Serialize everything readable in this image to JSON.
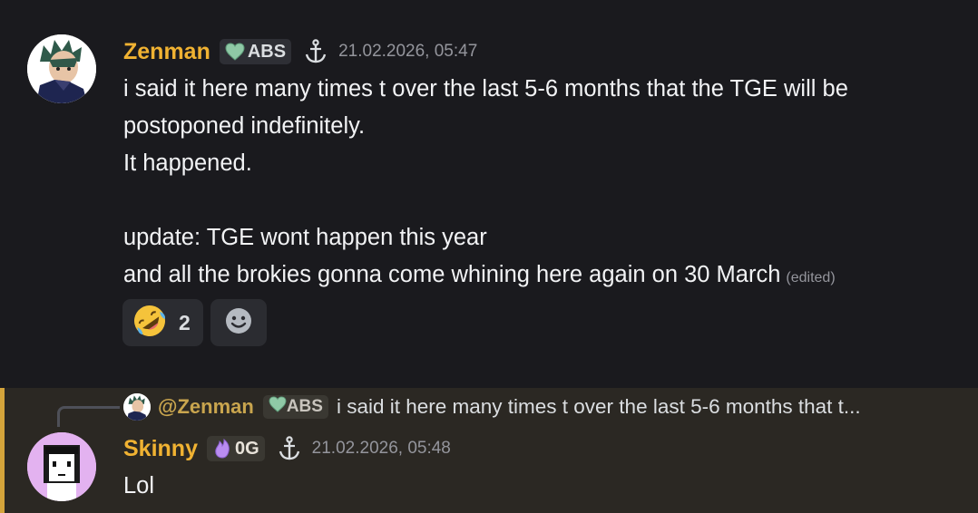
{
  "message1": {
    "username": "Zenman",
    "username_color": "#f0b232",
    "tag": {
      "icon": "green-heart-icon",
      "label": "ABS"
    },
    "badge_icon": "anchor-icon",
    "timestamp": "21.02.2026, 05:47",
    "lines": [
      "i said it here many times t over the last 5-6 months that the TGE will be",
      "postoponed indefinitely.",
      "It happened.",
      "update:  TGE wont happen this year",
      "and all the brokies gonna come whining here again on 30 March"
    ],
    "edited_label": "(edited)",
    "reactions": [
      {
        "emoji": "rolling-on-floor-laughing-emoji",
        "count": "2"
      }
    ],
    "add_reaction_icon": "smiley-add-reaction-icon"
  },
  "message2": {
    "reply": {
      "username": "@Zenman",
      "tag": {
        "icon": "green-heart-icon",
        "label": "ABS"
      },
      "text": "i said it here many times t over the last 5-6 months that t..."
    },
    "username": "Skinny",
    "tag": {
      "icon": "purple-flame-icon",
      "label": "0G"
    },
    "badge_icon": "anchor-icon",
    "timestamp": "21.02.2026, 05:48",
    "content": "Lol",
    "highlight_color": "#d4a43b"
  }
}
